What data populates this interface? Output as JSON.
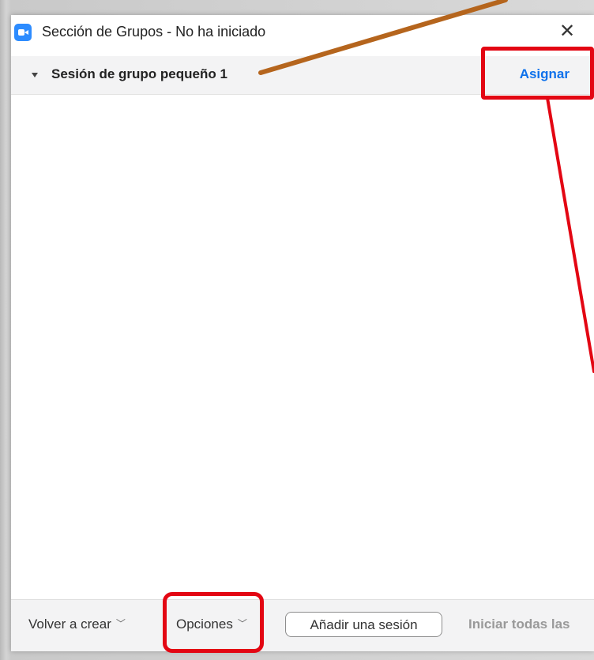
{
  "window": {
    "title": "Sección de Grupos - No ha iniciado",
    "close_label": "✕"
  },
  "session": {
    "name": "Sesión de grupo pequeño 1",
    "assign_label": "Asignar"
  },
  "footer": {
    "recreate_label": "Volver a crear",
    "options_label": "Opciones",
    "add_session_label": "Añadir una sesión",
    "start_all_label": "Iniciar todas las"
  },
  "colors": {
    "accent": "#0e71eb",
    "annotation_red": "#e30613",
    "annotation_brown": "#b5651d"
  },
  "icons": {
    "app": "zoom-camera-icon",
    "close": "close-icon",
    "collapse": "caret-down-icon",
    "chevron": "chevron-down-icon"
  }
}
